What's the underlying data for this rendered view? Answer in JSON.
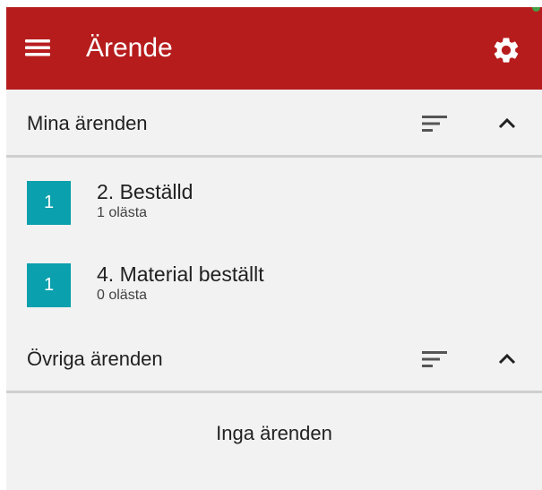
{
  "colors": {
    "appbar": "#b71c1c",
    "badge": "#0aa0ad",
    "background": "#f2f2f2",
    "divider": "#cfcfcf"
  },
  "appbar": {
    "title": "Ärende",
    "menu_icon": "hamburger-menu-icon",
    "settings_icon": "gear-icon"
  },
  "sections": [
    {
      "title": "Mina ärenden",
      "sort_icon": "sort-icon",
      "collapse_icon": "chevron-up-icon",
      "items": [
        {
          "count": "1",
          "title": "2. Beställd",
          "subtitle": "1 olästa"
        },
        {
          "count": "1",
          "title": "4. Material beställt",
          "subtitle": "0 olästa"
        }
      ]
    },
    {
      "title": "Övriga ärenden",
      "sort_icon": "sort-icon",
      "collapse_icon": "chevron-up-icon",
      "empty_text": "Inga ärenden"
    }
  ]
}
